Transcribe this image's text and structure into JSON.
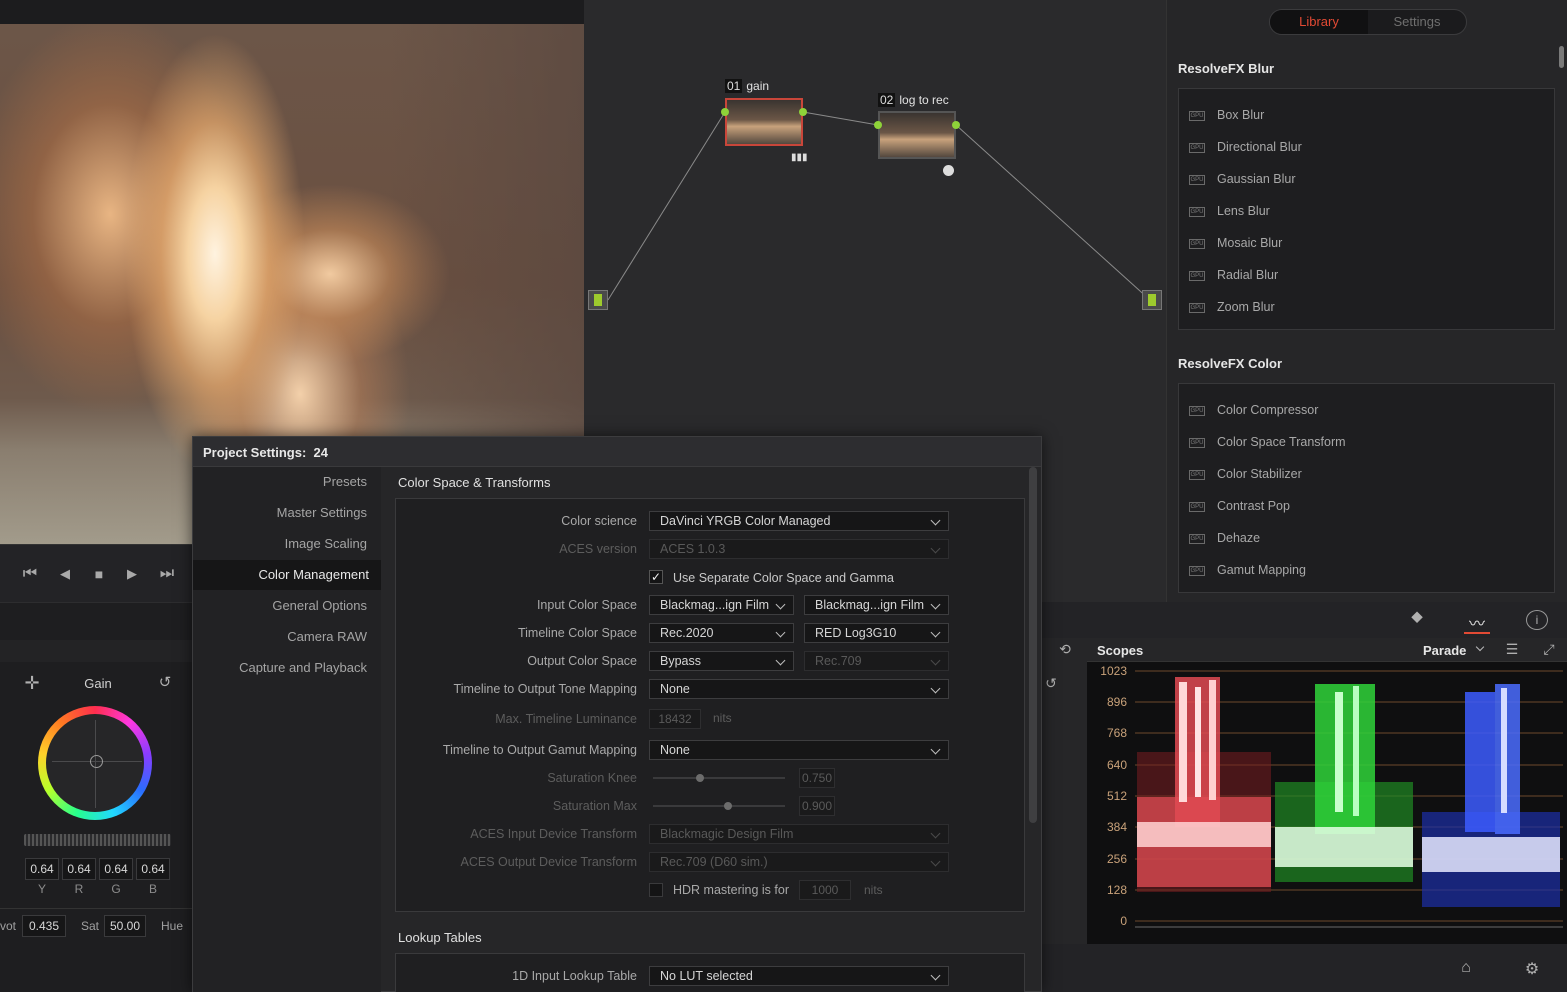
{
  "viewer": {
    "transport": [
      "⏮",
      "◀",
      "■",
      "▶",
      "⏭"
    ]
  },
  "nodes": [
    {
      "num": "01",
      "name": "gain"
    },
    {
      "num": "02",
      "name": "log to rec"
    }
  ],
  "library": {
    "tabs": [
      "Library",
      "Settings"
    ],
    "active_tab": "Library",
    "sections": [
      {
        "title": "ResolveFX Blur",
        "items": [
          "Box Blur",
          "Directional Blur",
          "Gaussian Blur",
          "Lens Blur",
          "Mosaic Blur",
          "Radial Blur",
          "Zoom Blur"
        ]
      },
      {
        "title": "ResolveFX Color",
        "items": [
          "Color Compressor",
          "Color Space Transform",
          "Color Stabilizer",
          "Contrast Pop",
          "Dehaze",
          "Gamut Mapping"
        ]
      }
    ],
    "badge": "GPU"
  },
  "color": {
    "title": "Gain",
    "values": [
      "0.64",
      "0.64",
      "0.64",
      "0.64"
    ],
    "channels": [
      "Y",
      "R",
      "G",
      "B"
    ],
    "pivot_label": "vot",
    "pivot": "0.435",
    "sat_label": "Sat",
    "sat": "50.00",
    "hue_label": "Hue"
  },
  "scopes": {
    "title": "Scopes",
    "mode": "Parade",
    "ticks": [
      "1023",
      "896",
      "768",
      "640",
      "512",
      "384",
      "256",
      "128",
      "0"
    ]
  },
  "dialog": {
    "title": "Project Settings:  24",
    "nav": [
      "Presets",
      "Master Settings",
      "Image Scaling",
      "Color Management",
      "General Options",
      "Camera RAW",
      "Capture and Playback"
    ],
    "nav_selected": "Color Management",
    "section1": "Color Space & Transforms",
    "color_science_label": "Color science",
    "color_science": "DaVinci YRGB Color Managed",
    "aces_version_label": "ACES version",
    "aces_version": "ACES 1.0.3",
    "separate_label": "Use Separate Color Space and Gamma",
    "input_cs_label": "Input Color Space",
    "input_cs": "Blackmag...ign Film",
    "input_gamma": "Blackmag...ign Film",
    "timeline_cs_label": "Timeline Color Space",
    "timeline_cs": "Rec.2020",
    "timeline_gamma": "RED Log3G10",
    "output_cs_label": "Output Color Space",
    "output_cs": "Bypass",
    "output_gamma": "Rec.709",
    "tone_label": "Timeline to Output Tone Mapping",
    "tone": "None",
    "lum_label": "Max. Timeline Luminance",
    "lum": "18432",
    "lum_unit": "nits",
    "gamut_label": "Timeline to Output Gamut Mapping",
    "gamut": "None",
    "knee_label": "Saturation Knee",
    "knee": "0.750",
    "satmax_label": "Saturation Max",
    "satmax": "0.900",
    "idt_label": "ACES Input Device Transform",
    "idt": "Blackmagic Design Film",
    "odt_label": "ACES Output Device Transform",
    "odt": "Rec.709 (D60 sim.)",
    "hdr_label": "HDR mastering is for",
    "hdr": "1000",
    "hdr_unit": "nits",
    "section2": "Lookup Tables",
    "lut_label": "1D Input Lookup Table",
    "lut": "No LUT selected"
  }
}
